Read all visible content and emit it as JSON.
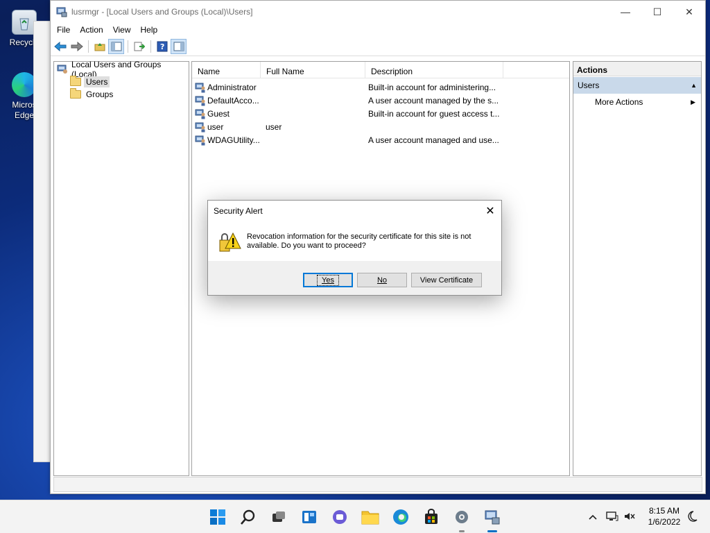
{
  "desktop": {
    "icons": [
      {
        "label": "Recycle",
        "name": "recycle-bin"
      },
      {
        "label": "Micros Edge",
        "name": "edge"
      }
    ]
  },
  "window": {
    "title": "lusrmgr - [Local Users and Groups (Local)\\Users]",
    "controls": {
      "minimize": "—",
      "maximize": "☐",
      "close": "✕"
    },
    "menu": [
      "File",
      "Action",
      "View",
      "Help"
    ]
  },
  "tree": {
    "root": "Local Users and Groups (Local)",
    "items": [
      {
        "label": "Users",
        "selected": true
      },
      {
        "label": "Groups",
        "selected": false
      }
    ]
  },
  "list": {
    "columns": [
      "Name",
      "Full Name",
      "Description"
    ],
    "rows": [
      {
        "name": "Administrator",
        "full_name": "",
        "description": "Built-in account for administering..."
      },
      {
        "name": "DefaultAcco...",
        "full_name": "",
        "description": "A user account managed by the s..."
      },
      {
        "name": "Guest",
        "full_name": "",
        "description": "Built-in account for guest access t..."
      },
      {
        "name": "user",
        "full_name": "user",
        "description": ""
      },
      {
        "name": "WDAGUtility...",
        "full_name": "",
        "description": "A user account managed and use..."
      }
    ]
  },
  "actions": {
    "header": "Actions",
    "section": "Users",
    "section_arrow": "▲",
    "item": "More Actions",
    "item_arrow": "▶"
  },
  "dialog": {
    "title": "Security Alert",
    "close": "✕",
    "message": "Revocation information for the security certificate for this site is not available. Do you want to proceed?",
    "buttons": {
      "yes": "Yes",
      "no": "No",
      "view": "View Certificate"
    }
  },
  "taskbar": {
    "time": "8:15 AM",
    "date": "1/6/2022",
    "tray_chevron": "^"
  },
  "colors": {
    "accent": "#0078d7",
    "section_bg": "#c9d9ea"
  }
}
